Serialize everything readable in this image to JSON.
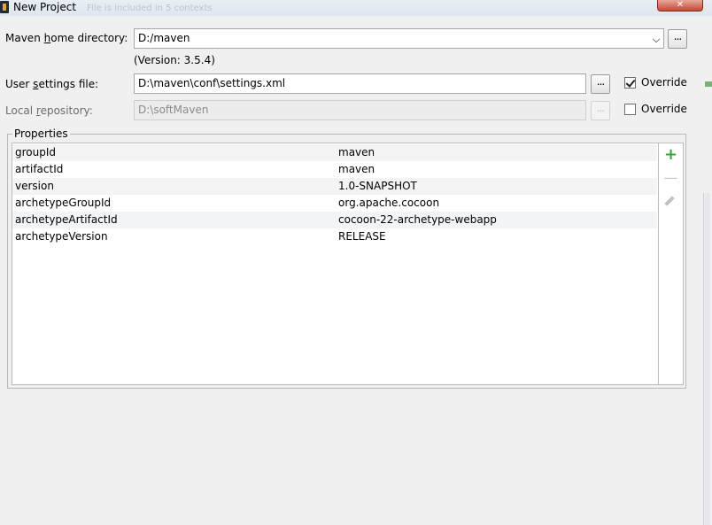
{
  "window": {
    "title": "New Project",
    "ghost_text": "File is included in 5 contexts"
  },
  "maven_home": {
    "label_before": "Maven ",
    "label_mnemonic": "h",
    "label_after": "ome directory:",
    "value": "D:/maven",
    "version": "(Version: 3.5.4)",
    "browse_label": "..."
  },
  "user_settings": {
    "label_before": "User ",
    "label_mnemonic": "s",
    "label_after": "ettings file:",
    "value": "D:\\maven\\conf\\settings.xml",
    "browse_label": "...",
    "override_label": "Override",
    "override_checked": true
  },
  "local_repo": {
    "label_before": "Local ",
    "label_mnemonic": "r",
    "label_after": "epository:",
    "value": "D:\\softMaven",
    "browse_label": "...",
    "override_label": "Override",
    "override_checked": false
  },
  "properties": {
    "title": "Properties",
    "rows": [
      {
        "key": "groupId",
        "value": "maven"
      },
      {
        "key": "artifactId",
        "value": "maven"
      },
      {
        "key": "version",
        "value": "1.0-SNAPSHOT"
      },
      {
        "key": "archetypeGroupId",
        "value": "org.apache.cocoon"
      },
      {
        "key": "archetypeArtifactId",
        "value": "cocoon-22-archetype-webapp"
      },
      {
        "key": "archetypeVersion",
        "value": "RELEASE"
      }
    ],
    "tools": {
      "add_label": "+",
      "remove_label": "—"
    }
  },
  "colors": {
    "accent_add": "#3ea23e",
    "close_button": "#c24a36"
  },
  "icons": [
    "app-icon",
    "close-icon",
    "chevron-down-icon",
    "plus-icon",
    "minus-icon",
    "pencil-icon"
  ]
}
